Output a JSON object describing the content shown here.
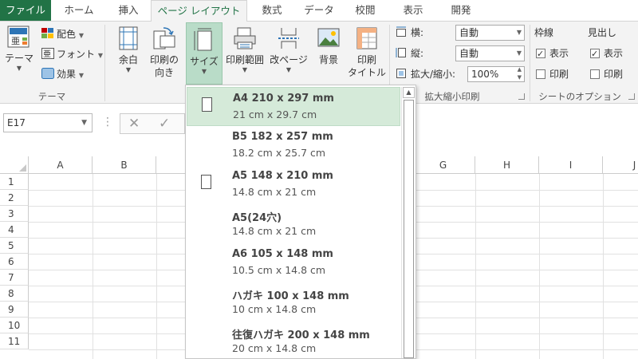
{
  "tabs": [
    {
      "label": "ファイル",
      "type": "file"
    },
    {
      "label": "ホーム"
    },
    {
      "label": "挿入"
    },
    {
      "label": "ページ レイアウト",
      "active": true
    },
    {
      "label": "数式"
    },
    {
      "label": "データ"
    },
    {
      "label": "校閲"
    },
    {
      "label": "表示"
    },
    {
      "label": "開発"
    }
  ],
  "ribbon": {
    "theme_group": {
      "label": "テーマ",
      "theme_button": "テーマ",
      "colors": "配色",
      "fonts": "フォント",
      "effects": "効果"
    },
    "page_setup": {
      "margins": "余白",
      "orientation_line1": "印刷の",
      "orientation_line2": "向き",
      "size": "サイズ",
      "print_area": "印刷範囲",
      "breaks": "改ページ",
      "background": "背景",
      "print_titles_line1": "印刷",
      "print_titles_line2": "タイトル"
    },
    "scale_group": {
      "label": "拡大縮小印刷",
      "width_label": "横:",
      "width_value": "自動",
      "height_label": "縦:",
      "height_value": "自動",
      "scale_label": "拡大/縮小:",
      "scale_value": "100%"
    },
    "sheet_options": {
      "label": "シートのオプション",
      "gridlines": "枠線",
      "headings": "見出し",
      "view": "表示",
      "print": "印刷",
      "gridlines_view": true,
      "gridlines_print": false,
      "headings_view": true,
      "headings_print": false
    }
  },
  "formula_bar": {
    "name_box": "E17"
  },
  "grid": {
    "columns": [
      "A",
      "B",
      "G",
      "H",
      "I",
      "J"
    ],
    "rows": [
      "1",
      "2",
      "3",
      "4",
      "5",
      "6",
      "7",
      "8",
      "9",
      "10",
      "11"
    ]
  },
  "size_menu": {
    "items": [
      {
        "name": "A4 210 x 297 mm",
        "dims": "21 cm x 29.7 cm",
        "selected": true,
        "icon": "page-portrait-icon"
      },
      {
        "name": "B5 182 x 257 mm",
        "dims": "18.2 cm x 25.7 cm"
      },
      {
        "name": "A5 148 x 210 mm",
        "dims": "14.8 cm x 21 cm",
        "icon": "page-portrait-icon"
      },
      {
        "name": "A5(24穴)",
        "dims": "14.8 cm x 21 cm"
      },
      {
        "name": "A6 105 x 148 mm",
        "dims": "10.5 cm x 14.8 cm"
      },
      {
        "name": "ハガキ 100 x 148 mm",
        "dims": "10 cm x 14.8 cm"
      },
      {
        "name": "往復ハガキ 200 x 148 mm",
        "dims": "20 cm x 14.8 cm"
      }
    ]
  },
  "colors": {
    "accent": "#217346",
    "selected_bg": "#d5ead9"
  }
}
